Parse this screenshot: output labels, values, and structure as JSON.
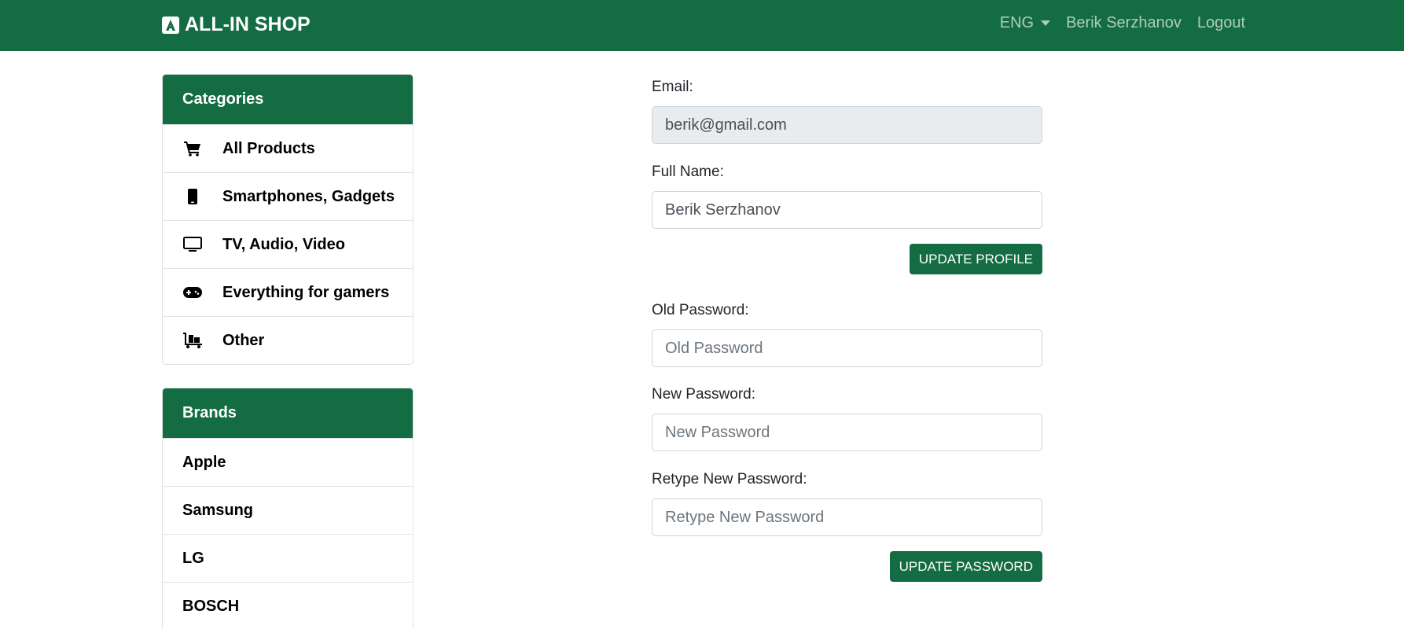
{
  "navbar": {
    "brand": "ALL-IN SHOP",
    "language": "ENG",
    "user_name": "Berik Serzhanov",
    "logout": "Logout"
  },
  "categories": {
    "title": "Categories",
    "items": [
      {
        "label": "All Products",
        "icon": "cart-icon"
      },
      {
        "label": "Smartphones, Gadgets",
        "icon": "smartphone-icon"
      },
      {
        "label": "TV, Audio, Video",
        "icon": "tv-icon"
      },
      {
        "label": "Everything for gamers",
        "icon": "gamepad-icon"
      },
      {
        "label": "Other",
        "icon": "dolly-icon"
      }
    ]
  },
  "brands": {
    "title": "Brands",
    "items": [
      "Apple",
      "Samsung",
      "LG",
      "BOSCH"
    ]
  },
  "profile": {
    "email_label": "Email:",
    "email_value": "berik@gmail.com",
    "fullname_label": "Full Name:",
    "fullname_value": "Berik Serzhanov",
    "update_profile": "UPDATE PROFILE"
  },
  "password": {
    "old_label": "Old Password:",
    "old_placeholder": "Old Password",
    "new_label": "New Password:",
    "new_placeholder": "New Password",
    "retype_label": "Retype New Password:",
    "retype_placeholder": "Retype New Password",
    "update_password": "UPDATE PASSWORD"
  },
  "colors": {
    "primary": "#146c43",
    "disabled_input": "#e9ecef"
  }
}
